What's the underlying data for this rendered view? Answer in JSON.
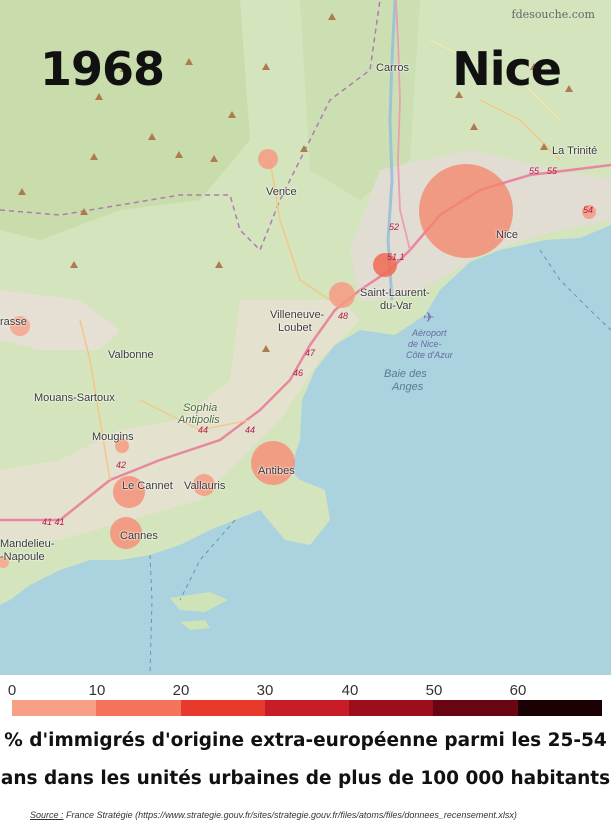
{
  "header": {
    "year": "1968",
    "city": "Nice",
    "watermark": "fdesouche.com"
  },
  "places": {
    "carros": "Carros",
    "la_trinite": "La Trinité",
    "vence": "Vence",
    "nice": "Nice",
    "saint_laurent_1": "Saint-Laurent-",
    "saint_laurent_2": "du-Var",
    "villeneuve_1": "Villeneuve-",
    "villeneuve_2": "Loubet",
    "grasse": "rasse",
    "valbonne": "Valbonne",
    "mouans": "Mouans-Sartoux",
    "sophia_1": "Sophia",
    "sophia_2": "Antipolis",
    "mougins": "Mougins",
    "le_cannet": "Le Cannet",
    "vallauris": "Vallauris",
    "antibes": "Antibes",
    "cannes": "Cannes",
    "mandelieu_1": "Mandelieu-",
    "mandelieu_2": "-Napoule",
    "baie_1": "Baie des",
    "baie_2": "Anges",
    "aeroport_1": "Aéroport",
    "aeroport_2": "de Nice-",
    "aeroport_3": "Côte d'Azur"
  },
  "roads": {
    "r55a": "55",
    "r55b": "55",
    "r54": "54",
    "r52": "52",
    "r511": "51,1",
    "r48": "48",
    "r47": "47",
    "r46": "46",
    "r44a": "44",
    "r44b": "44",
    "r42": "42",
    "r4141": "41 41"
  },
  "markers": [
    {
      "place": "Nice",
      "value": 8.0,
      "color": "#f4836a"
    },
    {
      "place": "Saint-Laurent-du-Var",
      "value": 8.5,
      "color": "#f06a52"
    },
    {
      "place": "Villeneuve-Loubet",
      "value": 5.5,
      "color": "#f69a82"
    },
    {
      "place": "Vence",
      "value": 5.5,
      "color": "#f69a82"
    },
    {
      "place": "Grasse",
      "value": 5.0,
      "color": "#f8a48c"
    },
    {
      "place": "Mougins",
      "value": 6.0,
      "color": "#f69a82"
    },
    {
      "place": "Le Cannet",
      "value": 6.5,
      "color": "#f4907a"
    },
    {
      "place": "Vallauris",
      "value": 5.5,
      "color": "#f69a82"
    },
    {
      "place": "Antibes",
      "value": 6.0,
      "color": "#f4907a"
    },
    {
      "place": "Cannes",
      "value": 6.5,
      "color": "#f4907a"
    },
    {
      "place": "Mandelieu-la-Napoule",
      "value": 5.0,
      "color": "#f8a48c"
    },
    {
      "place": "La Trinité",
      "value": 6.0,
      "color": "#f69a82"
    }
  ],
  "legend": {
    "ticks": [
      "0",
      "10",
      "20",
      "30",
      "40",
      "50",
      "60"
    ],
    "colors": [
      "#f8a085",
      "#f4735a",
      "#e83a2c",
      "#c81c28",
      "#9c0e1c",
      "#6a0612",
      "#1a0204"
    ]
  },
  "caption": {
    "line1": "% d'immigrés d'origine extra-européenne parmi les 25-54",
    "line2": "ans dans les unités urbaines de plus de 100 000 habitants"
  },
  "source": {
    "label": "Source :",
    "text": "France Stratégie (https://www.strategie.gouv.fr/sites/strategie.gouv.fr/files/atoms/files/donnees_recensement.xlsx)"
  }
}
